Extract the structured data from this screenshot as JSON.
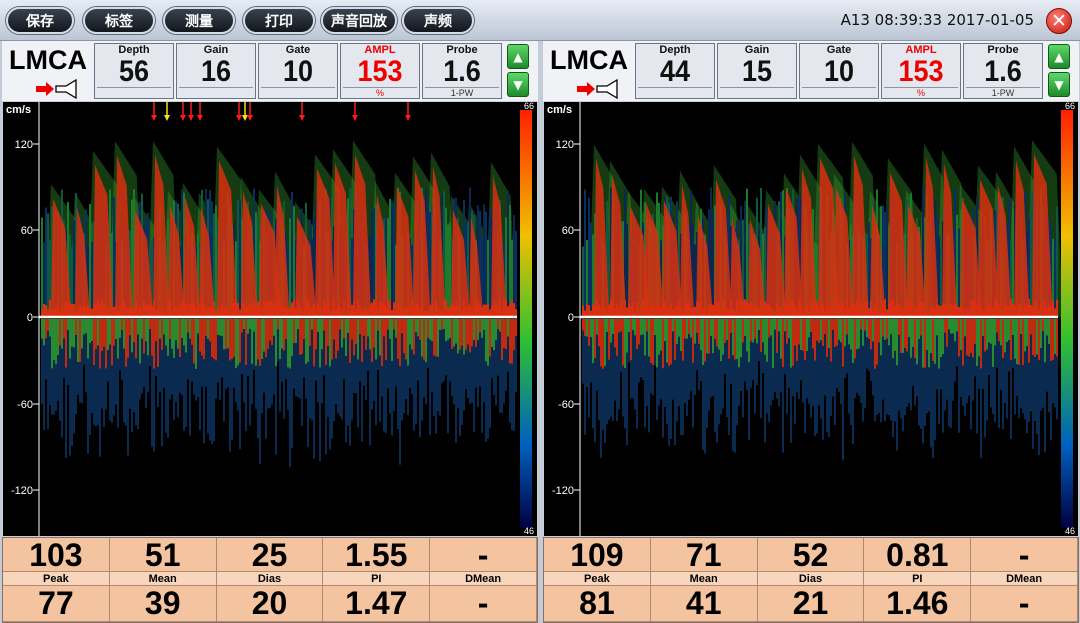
{
  "toolbar": {
    "buttons": [
      "保存",
      "标签",
      "测量",
      "打印",
      "声音回放",
      "声频"
    ],
    "status": "A13 08:39:33 2017-01-05",
    "close_icon": "close-icon"
  },
  "colors": {
    "accent_red": "#e00000",
    "measure_bg": "#f4c4a0",
    "button_dark": "#1a1e26"
  },
  "panels": [
    {
      "vessel": "LMCA",
      "params": [
        {
          "label": "Depth",
          "value": "56",
          "sub": ""
        },
        {
          "label": "Gain",
          "value": "16",
          "sub": ""
        },
        {
          "label": "Gate",
          "value": "10",
          "sub": ""
        },
        {
          "label": "AMPL",
          "value": "153",
          "sub": "%"
        },
        {
          "label": "Probe",
          "value": "1.6",
          "sub": "1-PW"
        }
      ],
      "spectrum": {
        "unit": "cm/s",
        "ticks": [
          "120",
          "60",
          "0",
          "-60",
          "-120"
        ],
        "scale_top": "66",
        "scale_bottom": "46"
      },
      "measurements": {
        "top": [
          "103",
          "51",
          "25",
          "1.55",
          "-"
        ],
        "labels": [
          "Peak",
          "Mean",
          "Dias",
          "PI",
          "DMean"
        ],
        "bottom": [
          "77",
          "39",
          "20",
          "1.47",
          "-"
        ]
      }
    },
    {
      "vessel": "LMCA",
      "params": [
        {
          "label": "Depth",
          "value": "44",
          "sub": ""
        },
        {
          "label": "Gain",
          "value": "15",
          "sub": ""
        },
        {
          "label": "Gate",
          "value": "10",
          "sub": ""
        },
        {
          "label": "AMPL",
          "value": "153",
          "sub": "%"
        },
        {
          "label": "Probe",
          "value": "1.6",
          "sub": "1-PW"
        }
      ],
      "spectrum": {
        "unit": "cm/s",
        "ticks": [
          "120",
          "60",
          "0",
          "-60",
          "-120"
        ],
        "scale_top": "66",
        "scale_bottom": "46"
      },
      "measurements": {
        "top": [
          "109",
          "71",
          "52",
          "0.81",
          "-"
        ],
        "labels": [
          "Peak",
          "Mean",
          "Dias",
          "PI",
          "DMean"
        ],
        "bottom": [
          "81",
          "41",
          "21",
          "1.46",
          "-"
        ]
      }
    }
  ],
  "markers": {
    "colors": [
      "red",
      "yellow",
      "red",
      "red",
      "red",
      "red",
      "yellow",
      "red",
      "red",
      "red",
      "red"
    ]
  }
}
